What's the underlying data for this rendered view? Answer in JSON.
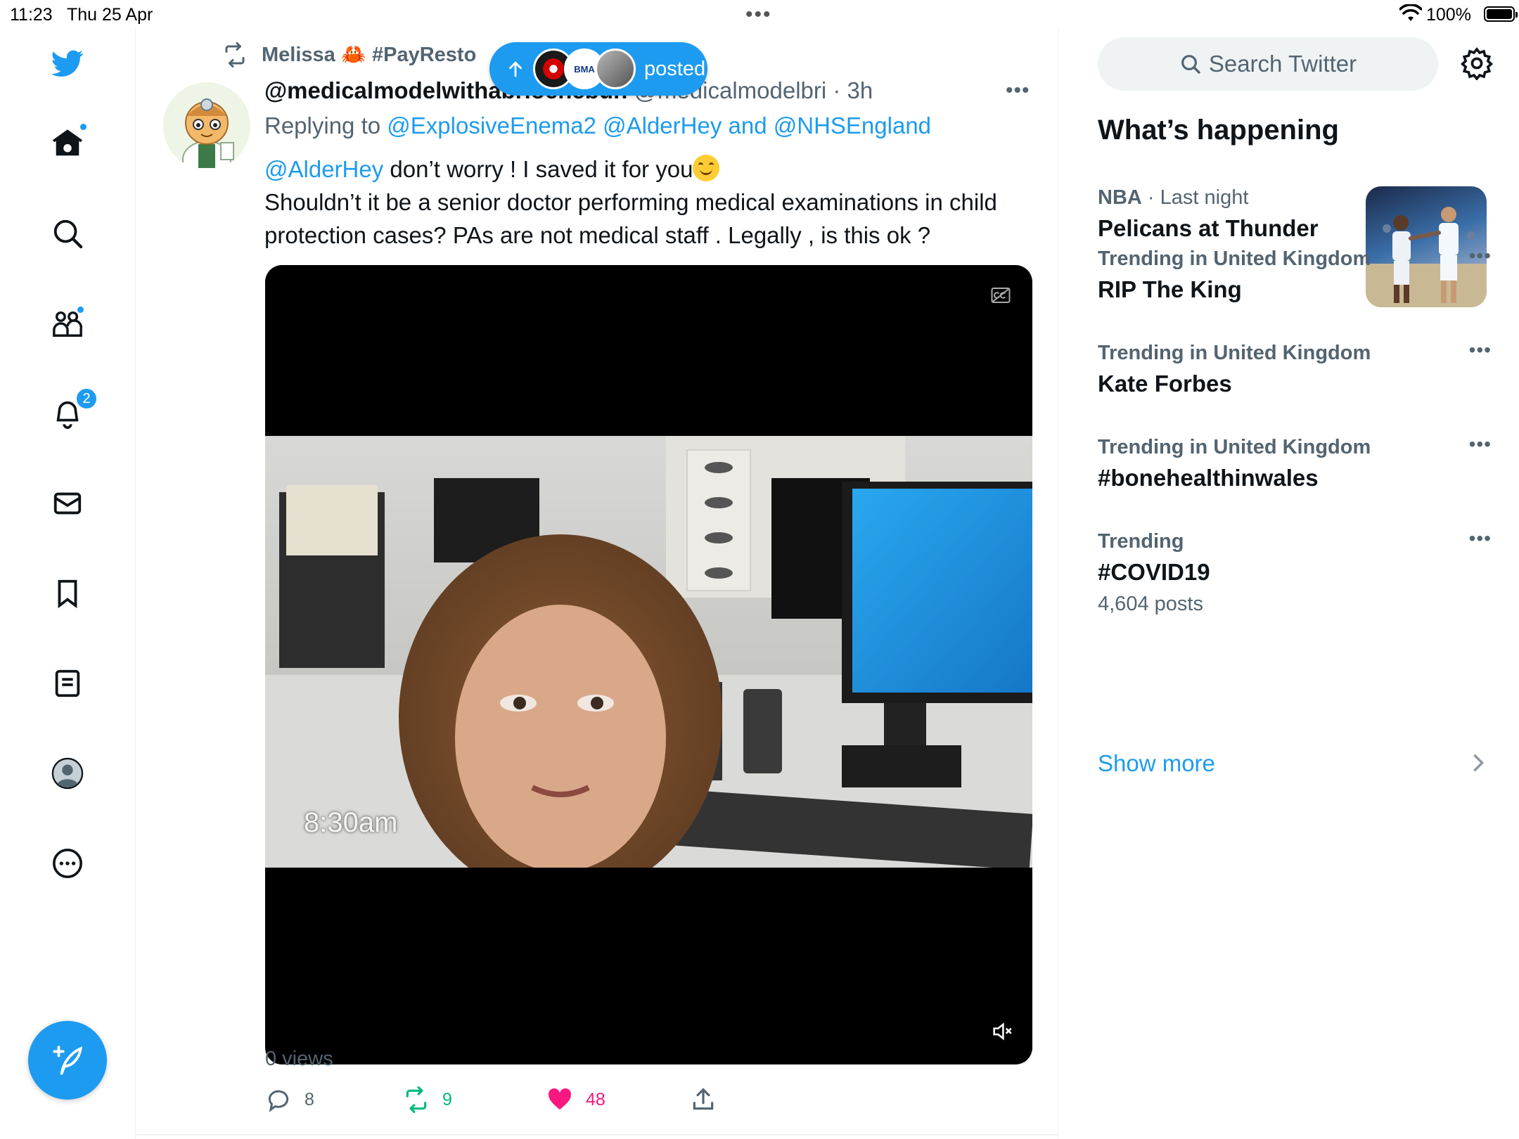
{
  "status_bar": {
    "time": "11:23",
    "date": "Thu 25 Apr",
    "battery": "100%"
  },
  "nav": {
    "items": [
      "twitter-logo",
      "home-icon",
      "search-icon",
      "communities-icon",
      "notifications-icon",
      "messages-icon",
      "bookmarks-icon",
      "lists-icon",
      "profile-icon",
      "more-icon"
    ],
    "notifications_badge": "2"
  },
  "new_posts_pill": {
    "label": "posted",
    "bma_text": "BMA"
  },
  "tweet": {
    "retweeted_by": "Melissa 🦀 #PayResto",
    "display_name": "@medicalmodelwithabriochebun",
    "handle": "@medicalmodelbri",
    "time": "3h",
    "replying_prefix": "Replying to",
    "replying_to": [
      "@ExplosiveEnema2",
      "@AlderHey",
      "and",
      "@NHSEngland"
    ],
    "mention": "@AlderHey",
    "text_line1": " don’t worry ! I saved it for you",
    "text_rest": "Shouldn’t it be a senior doctor performing medical examinations in child protection cases? PAs are not medical staff . Legally , is this ok ?",
    "video_timestamp": "8:30am",
    "views": "0 views",
    "replies": "8",
    "retweets": "9",
    "likes": "48"
  },
  "sidebar": {
    "search_placeholder": "Search Twitter",
    "heading": "What’s happening",
    "featured": {
      "category": "NBA",
      "time": "Last night",
      "title": "Pelicans at Thunder"
    },
    "trends": [
      {
        "meta": "Trending in United Kingdom",
        "title": "RIP The King",
        "posts": ""
      },
      {
        "meta": "Trending in United Kingdom",
        "title": "Kate Forbes",
        "posts": ""
      },
      {
        "meta": "Trending in United Kingdom",
        "title": "#bonehealthinwales",
        "posts": ""
      },
      {
        "meta": "Trending",
        "title": "#COVID19",
        "posts": "4,604 posts"
      }
    ],
    "show_more": "Show more"
  },
  "colors": {
    "accent": "#1d9bf0",
    "like": "#f91880",
    "retweet": "#00ba7c",
    "muted": "#536471"
  }
}
